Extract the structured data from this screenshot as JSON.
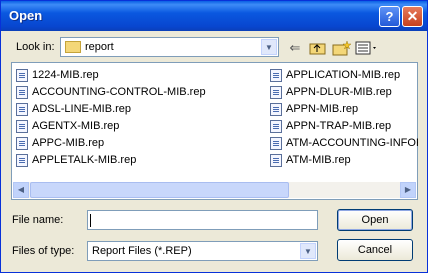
{
  "dialog": {
    "title": "Open",
    "help_glyph": "?",
    "close_glyph": "✕"
  },
  "lookin": {
    "label": "Look in:",
    "value": "report"
  },
  "toolbar": {
    "back_icon": "back-arrow-icon",
    "up_icon": "up-folder-icon",
    "new_icon": "new-folder-icon",
    "view_icon": "view-menu-icon"
  },
  "files": {
    "col1": [
      "1224-MIB.rep",
      "ACCOUNTING-CONTROL-MIB.rep",
      "ADSL-LINE-MIB.rep",
      "AGENTX-MIB.rep",
      "APPC-MIB.rep",
      "APPLETALK-MIB.rep"
    ],
    "col2": [
      "APPLICATION-MIB.rep",
      "APPN-DLUR-MIB.rep",
      "APPN-MIB.rep",
      "APPN-TRAP-MIB.rep",
      "ATM-ACCOUNTING-INFORMATION-MIB.rep",
      "ATM-MIB.rep"
    ]
  },
  "filename": {
    "label": "File name:",
    "value": ""
  },
  "filetype": {
    "label": "Files of type:",
    "value": "Report Files (*.REP)"
  },
  "buttons": {
    "open": "Open",
    "cancel": "Cancel"
  }
}
